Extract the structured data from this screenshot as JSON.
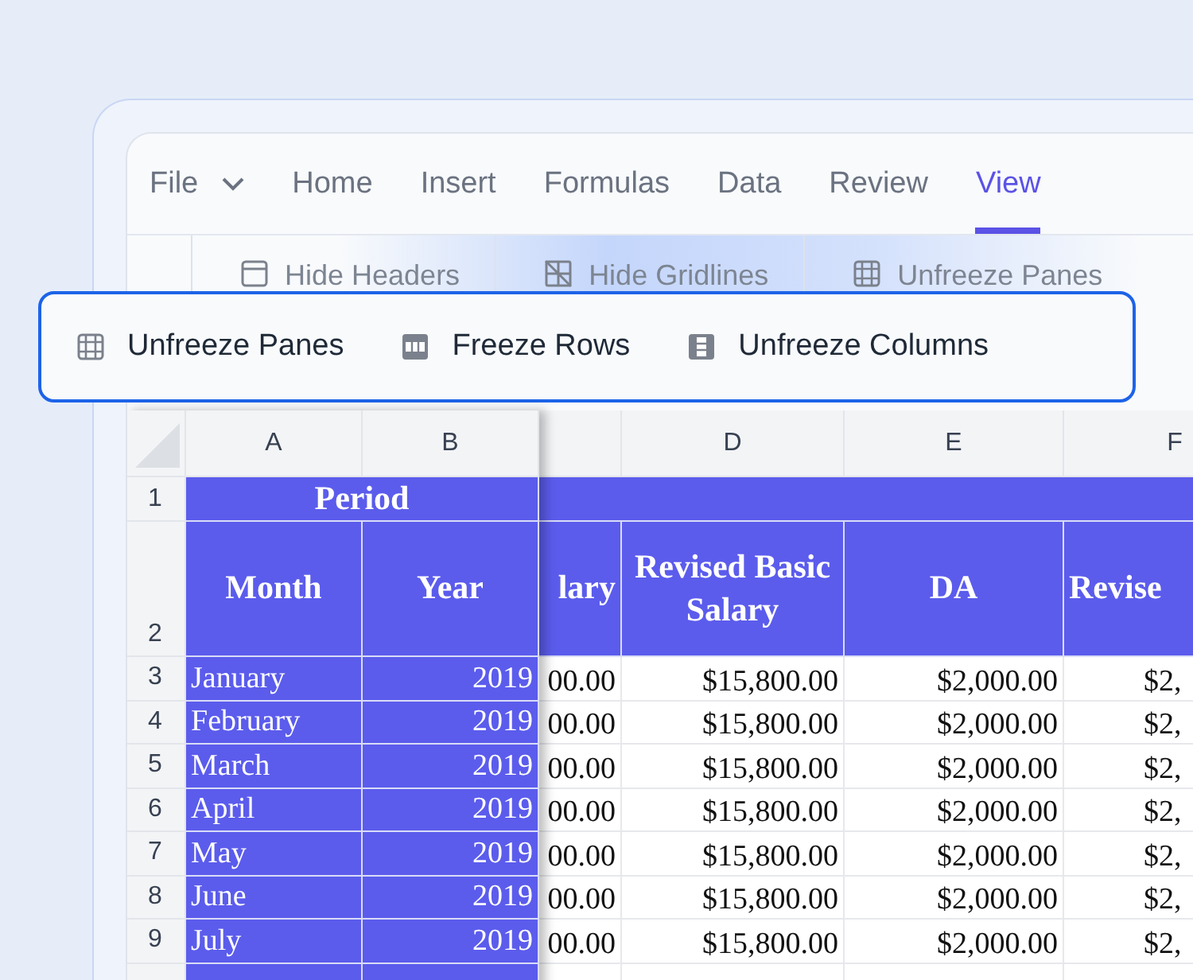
{
  "menu": {
    "file": "File",
    "tabs": [
      {
        "label": "Home",
        "selected": false
      },
      {
        "label": "Insert",
        "selected": false
      },
      {
        "label": "Formulas",
        "selected": false
      },
      {
        "label": "Data",
        "selected": false
      },
      {
        "label": "Review",
        "selected": false
      },
      {
        "label": "View",
        "selected": true
      }
    ]
  },
  "ribbon": [
    {
      "label": "Hide Headers",
      "kind": "headers"
    },
    {
      "label": "Hide Gridlines",
      "kind": "gridlines"
    },
    {
      "label": "Unfreeze Panes",
      "kind": "panes"
    }
  ],
  "popup": [
    {
      "label": "Unfreeze Panes",
      "kind": "panes"
    },
    {
      "label": "Freeze Rows",
      "kind": "rows"
    },
    {
      "label": "Unfreeze Columns",
      "kind": "columns"
    }
  ],
  "sheet": {
    "frozen_columns": [
      "A",
      "B"
    ],
    "scroll_columns": [
      "",
      "D",
      "E",
      "F"
    ],
    "period": "Period",
    "frozen_headers": [
      "Month",
      "Year"
    ],
    "scroll_headers": [
      "lary",
      "Revised Basic Salary",
      "DA",
      "Revise"
    ],
    "header_row_numbers": [
      "1",
      "2"
    ],
    "rows": [
      {
        "number": "3",
        "month": "January",
        "year": "2019",
        "cells": [
          "00.00",
          "$15,800.00",
          "$2,000.00",
          "$2,"
        ]
      },
      {
        "number": "4",
        "month": "February",
        "year": "2019",
        "cells": [
          "00.00",
          "$15,800.00",
          "$2,000.00",
          "$2,"
        ]
      },
      {
        "number": "5",
        "month": "March",
        "year": "2019",
        "cells": [
          "00.00",
          "$15,800.00",
          "$2,000.00",
          "$2,"
        ]
      },
      {
        "number": "6",
        "month": "April",
        "year": "2019",
        "cells": [
          "00.00",
          "$15,800.00",
          "$2,000.00",
          "$2,"
        ]
      },
      {
        "number": "7",
        "month": "May",
        "year": "2019",
        "cells": [
          "00.00",
          "$15,800.00",
          "$2,000.00",
          "$2,"
        ]
      },
      {
        "number": "8",
        "month": "June",
        "year": "2019",
        "cells": [
          "00.00",
          "$15,800.00",
          "$2,000.00",
          "$2,"
        ]
      },
      {
        "number": "9",
        "month": "July",
        "year": "2019",
        "cells": [
          "00.00",
          "$15,800.00",
          "$2,000.00",
          "$2,"
        ]
      }
    ]
  }
}
